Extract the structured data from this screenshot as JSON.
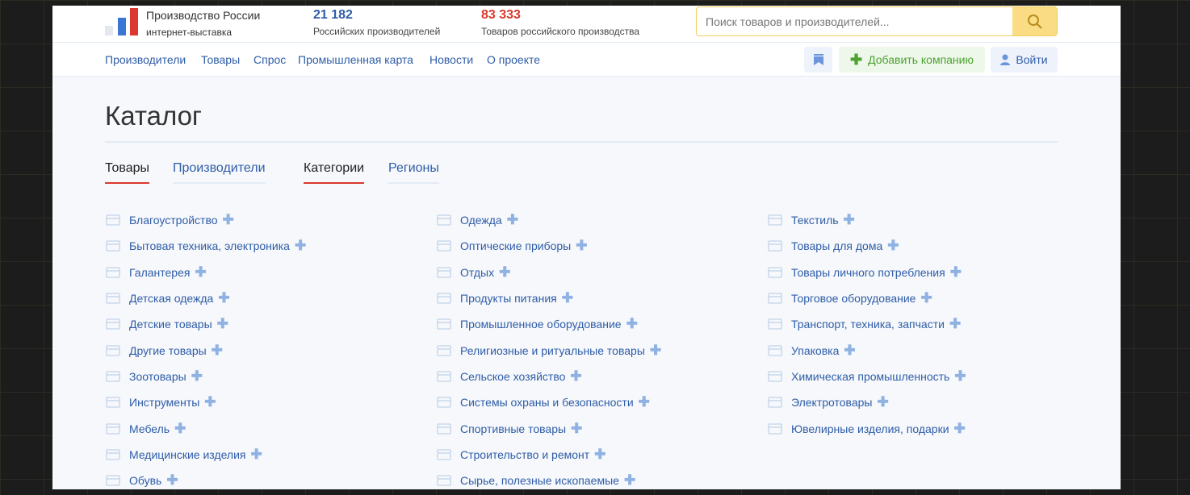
{
  "header": {
    "brand_title": "Производство России",
    "brand_subtitle": "интернет-выставка",
    "stats": [
      {
        "value": "21 182",
        "label": "Российских производителей",
        "color": "#2f5da8"
      },
      {
        "value": "83 333",
        "label": "Товаров российского производства",
        "color": "#d9392e"
      }
    ],
    "search_placeholder": "Поиск товаров и производителей..."
  },
  "nav": {
    "links": [
      "Производители",
      "Товары",
      "Спрос",
      "Промышленная карта",
      "Новости",
      "О проекте"
    ],
    "add_company": "Добавить компанию",
    "login": "Войти"
  },
  "main": {
    "title": "Каталог",
    "tabs": [
      "Товары",
      "Производители",
      "Категории",
      "Регионы"
    ],
    "columns": [
      [
        "Благоустройство",
        "Бытовая техника, электроника",
        "Галантерея",
        "Детская одежда",
        "Детские товары",
        "Другие товары",
        "Зоотовары",
        "Инструменты",
        "Мебель",
        "Медицинские изделия",
        "Обувь"
      ],
      [
        "Одежда",
        "Оптические приборы",
        "Отдых",
        "Продукты питания",
        "Промышленное оборудование",
        "Религиозные и ритуальные товары",
        "Сельское хозяйство",
        "Системы охраны и безопасности",
        "Спортивные товары",
        "Строительство и ремонт",
        "Сырье, полезные ископаемые"
      ],
      [
        "Текстиль",
        "Товары для дома",
        "Товары личного потребления",
        "Торговое оборудование",
        "Транспорт, техника, запчасти",
        "Упаковка",
        "Химическая промышленность",
        "Электротовары",
        "Ювелирные изделия, подарки"
      ]
    ]
  }
}
